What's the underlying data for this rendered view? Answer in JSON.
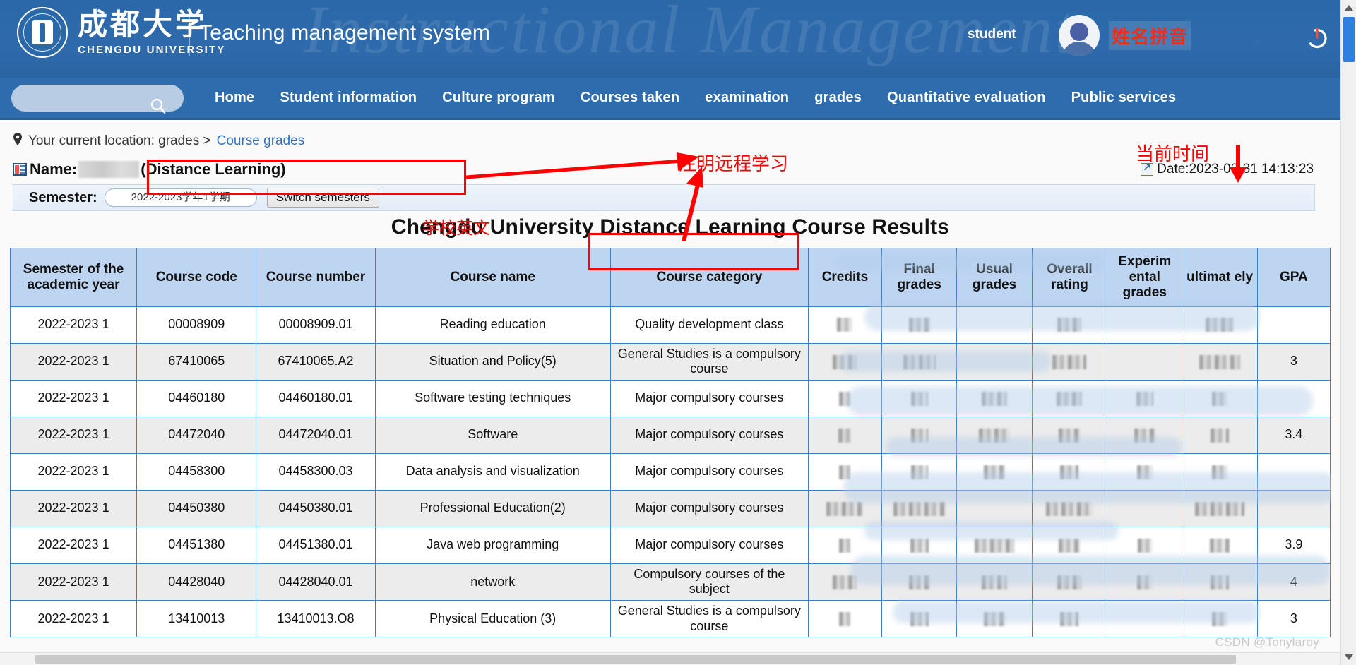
{
  "header": {
    "university_cn": "成都大学",
    "university_en": "CHENGDU UNIVERSITY",
    "system_title": "Teaching management system",
    "watermark": "Instructional Management",
    "user_role": "student",
    "user_name": "姓名拼音",
    "power_icon": "power-icon",
    "avatar_icon": "avatar-icon"
  },
  "nav": {
    "search_placeholder": "",
    "search_value": "",
    "search_icon": "search-icon",
    "items": [
      {
        "label": "Home"
      },
      {
        "label": "Student information"
      },
      {
        "label": "Culture program"
      },
      {
        "label": "Courses taken"
      },
      {
        "label": "examination"
      },
      {
        "label": "grades"
      },
      {
        "label": "Quantitative evaluation"
      },
      {
        "label": "Public services"
      }
    ]
  },
  "breadcrumb": {
    "pin_icon": "location-pin-icon",
    "prefix": "Your current location: grades >",
    "current": "Course grades"
  },
  "student": {
    "name_icon": "id-card-icon",
    "name_label": "Name:",
    "name_value_redacted": true,
    "name_suffix": "(Distance Learning)"
  },
  "datetime": {
    "icon": "shortcut-arrow-icon",
    "text": "Date:2023-03-31 14:13:23"
  },
  "semester": {
    "label": "Semester:",
    "selected": "2022-2023学年1学期",
    "switch_button": "Switch semesters"
  },
  "page_title": {
    "part1": "Chengdu University",
    "part2": "Distance Learning",
    "part3": "Course Results"
  },
  "annotations": [
    {
      "id": "note-distance-learning",
      "text": "注明远程学习"
    },
    {
      "id": "note-current-time",
      "text": "当前时间"
    },
    {
      "id": "note-school-english",
      "text": "学校英文"
    }
  ],
  "table": {
    "columns": [
      "Semester of the academic year",
      "Course code",
      "Course number",
      "Course name",
      "Course category",
      "Credits",
      "Final grades",
      "Usual grades",
      "Overall rating",
      "Experim ental grades",
      "ultimat ely",
      "GPA"
    ],
    "rows": [
      {
        "semester": "2022-2023 1",
        "course_code": "00008909",
        "course_number": "00008909.01",
        "course_name": "Reading education",
        "course_category": "Quality development class",
        "credits": "",
        "final_grades": "",
        "usual_grades": "",
        "overall_rating": "",
        "experimental_grades": "",
        "ultimately": "",
        "gpa": ""
      },
      {
        "semester": "2022-2023 1",
        "course_code": "67410065",
        "course_number": "67410065.A2",
        "course_name": "Situation and Policy(5)",
        "course_category": "General Studies is a compulsory course",
        "credits": "",
        "final_grades": "",
        "usual_grades": "",
        "overall_rating": "",
        "experimental_grades": "",
        "ultimately": "",
        "gpa": "3"
      },
      {
        "semester": "2022-2023 1",
        "course_code": "04460180",
        "course_number": "04460180.01",
        "course_name": "Software testing techniques",
        "course_category": "Major compulsory courses",
        "credits": "",
        "final_grades": "",
        "usual_grades": "",
        "overall_rating": "",
        "experimental_grades": "",
        "ultimately": "",
        "gpa": ""
      },
      {
        "semester": "2022-2023 1",
        "course_code": "04472040",
        "course_number": "04472040.01",
        "course_name": "Software",
        "course_category": "Major compulsory courses",
        "credits": "",
        "final_grades": "",
        "usual_grades": "",
        "overall_rating": "",
        "experimental_grades": "",
        "ultimately": "",
        "gpa": "3.4"
      },
      {
        "semester": "2022-2023 1",
        "course_code": "04458300",
        "course_number": "04458300.03",
        "course_name": "Data analysis and visualization",
        "course_category": "Major compulsory courses",
        "credits": "",
        "final_grades": "",
        "usual_grades": "",
        "overall_rating": "",
        "experimental_grades": "",
        "ultimately": "",
        "gpa": ""
      },
      {
        "semester": "2022-2023 1",
        "course_code": "04450380",
        "course_number": "04450380.01",
        "course_name": "Professional Education(2)",
        "course_category": "Major compulsory courses",
        "credits": "",
        "final_grades": "",
        "usual_grades": "",
        "overall_rating": "",
        "experimental_grades": "",
        "ultimately": "",
        "gpa": ""
      },
      {
        "semester": "2022-2023 1",
        "course_code": "04451380",
        "course_number": "04451380.01",
        "course_name": "Java web programming",
        "course_category": "Major compulsory courses",
        "credits": "",
        "final_grades": "",
        "usual_grades": "",
        "overall_rating": "",
        "experimental_grades": "",
        "ultimately": "",
        "gpa": "3.9"
      },
      {
        "semester": "2022-2023 1",
        "course_code": "04428040",
        "course_number": "04428040.01",
        "course_name": "network",
        "course_category": "Compulsory courses of the subject",
        "credits": "",
        "final_grades": "",
        "usual_grades": "",
        "overall_rating": "",
        "experimental_grades": "",
        "ultimately": "",
        "gpa": "4"
      },
      {
        "semester": "2022-2023 1",
        "course_code": "13410013",
        "course_number": "13410013.O8",
        "course_name": "Physical Education (3)",
        "course_category": "General Studies is a compulsory course",
        "credits": "",
        "final_grades": "",
        "usual_grades": "",
        "overall_rating": "",
        "experimental_grades": "",
        "ultimately": "",
        "gpa": "3"
      }
    ]
  },
  "watermark": "CSDN @Tonylaroy",
  "colors": {
    "header_blue": "#2f6cad",
    "nav_blue": "#2f6cad",
    "table_header": "#bed5f2",
    "border_blue": "#3f7fc1",
    "annotation_red": "#ff0000",
    "link_blue": "#2f72c4",
    "name_red": "#f22c16"
  }
}
